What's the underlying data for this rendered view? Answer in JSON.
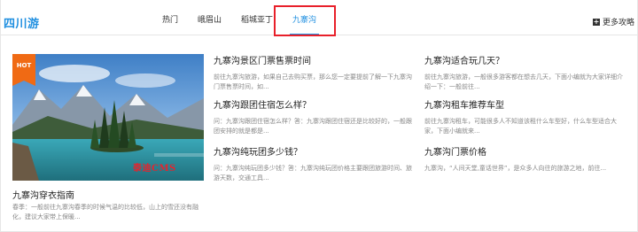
{
  "header": {
    "logo": "四川游",
    "tabs": [
      {
        "label": "热门"
      },
      {
        "label": "峨眉山"
      },
      {
        "label": "稻城亚丁"
      },
      {
        "label": "九寨沟"
      }
    ],
    "active_tab": "九寨沟",
    "more_label": "更多攻略",
    "accent_color": "#1f8fe0",
    "highlight_color": "#e8202a"
  },
  "feature": {
    "badge": "HOT",
    "watermark": "泰迪CMS",
    "title": "九寨沟穿衣指南",
    "desc": "春季：一般前往九寨沟春季的时候气温的比较低，山上的雪还没有融化，建议大家带上保暖..."
  },
  "articles": [
    {
      "title": "九寨沟景区门票售票时间",
      "desc": "前往九寨沟旅游，如果自己去购买票，那么您一定要提前了解一下九寨沟门票售票时间，如..."
    },
    {
      "title": "九寨沟跟团住宿怎么样？",
      "desc": "问：九寨沟跟团住宿怎么样？答：九寨沟跟团住宿还是比较好的，一般跟团安排的就是都是..."
    },
    {
      "title": "九寨沟纯玩团多少钱？",
      "desc": "问：九寨沟纯玩团多少钱？答：九寨沟纯玩团价格主要跟团旅游时间、旅游天数，交通工具..."
    },
    {
      "title": "九寨沟适合玩几天？",
      "desc": "前往九寨沟旅游，一般很多游客都在想去几天，下面小编就为大家详细介绍一下：一般前往..."
    },
    {
      "title": "九寨沟租车推荐车型",
      "desc": "前往九寨沟租车，可能很多人不知道该租什么车型好，什么车型适合大家，下面小编就来..."
    },
    {
      "title": "九寨沟门票价格",
      "desc": "九寨沟，“人间天堂,童话世界”，是众多人向往的旅游之地，前往..."
    }
  ]
}
